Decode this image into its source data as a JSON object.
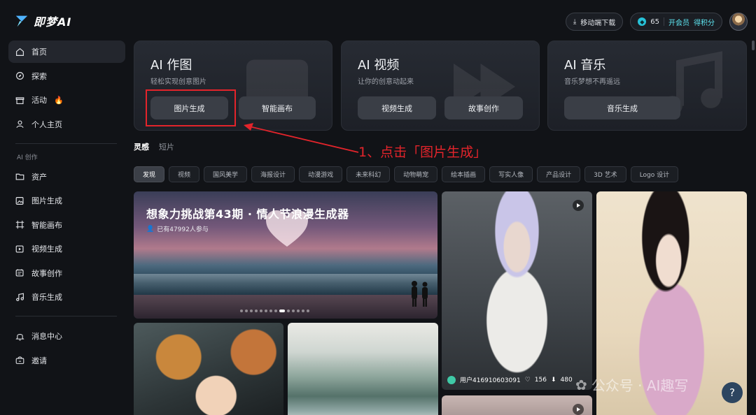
{
  "app": {
    "logo_text": "即梦AI"
  },
  "topbar": {
    "mobile_download": "移动端下载",
    "credits": "65",
    "membership": "开会员",
    "earn_points": "得积分"
  },
  "sidebar": {
    "items": [
      {
        "label": "首页",
        "icon": "home-icon"
      },
      {
        "label": "探索",
        "icon": "compass-icon"
      },
      {
        "label": "活动",
        "icon": "gift-icon",
        "badge": "🔥"
      },
      {
        "label": "个人主页",
        "icon": "user-icon"
      }
    ],
    "section_title": "AI 创作",
    "create_items": [
      {
        "label": "资产",
        "icon": "folder-icon"
      },
      {
        "label": "图片生成",
        "icon": "image-gen-icon"
      },
      {
        "label": "智能画布",
        "icon": "canvas-icon"
      },
      {
        "label": "视频生成",
        "icon": "video-gen-icon"
      },
      {
        "label": "故事创作",
        "icon": "story-icon"
      },
      {
        "label": "音乐生成",
        "icon": "music-icon"
      }
    ],
    "bottom_items": [
      {
        "label": "消息中心",
        "icon": "bell-icon"
      },
      {
        "label": "邀请",
        "icon": "invite-icon"
      }
    ]
  },
  "cards": [
    {
      "title": "AI 作图",
      "subtitle": "轻松实现创意图片",
      "buttons": [
        "图片生成",
        "智能画布"
      ]
    },
    {
      "title": "AI 视频",
      "subtitle": "让你的创意动起来",
      "buttons": [
        "视频生成",
        "故事创作"
      ]
    },
    {
      "title": "AI 音乐",
      "subtitle": "音乐梦想不再遥远",
      "buttons": [
        "音乐生成"
      ]
    }
  ],
  "annotation": {
    "text": "1、点击「图片生成」",
    "color": "#e3242b"
  },
  "tabs": [
    "灵感",
    "短片"
  ],
  "chips": [
    "发现",
    "视频",
    "国风美学",
    "海报设计",
    "动漫游戏",
    "未来科幻",
    "动物萌宠",
    "绘本插画",
    "写实人像",
    "产品设计",
    "3D 艺术",
    "Logo 设计"
  ],
  "banner": {
    "title": "想象力挑战第43期 · 情人节浪漫生成器",
    "participants": "已有47992人参与",
    "slide_count": 14,
    "active_slide": 8
  },
  "gallery": {
    "robot_author": "用户416910603091",
    "robot_likes": "156",
    "robot_views": "480"
  },
  "watermark": "公众号 · AI趣写",
  "help_label": "?"
}
